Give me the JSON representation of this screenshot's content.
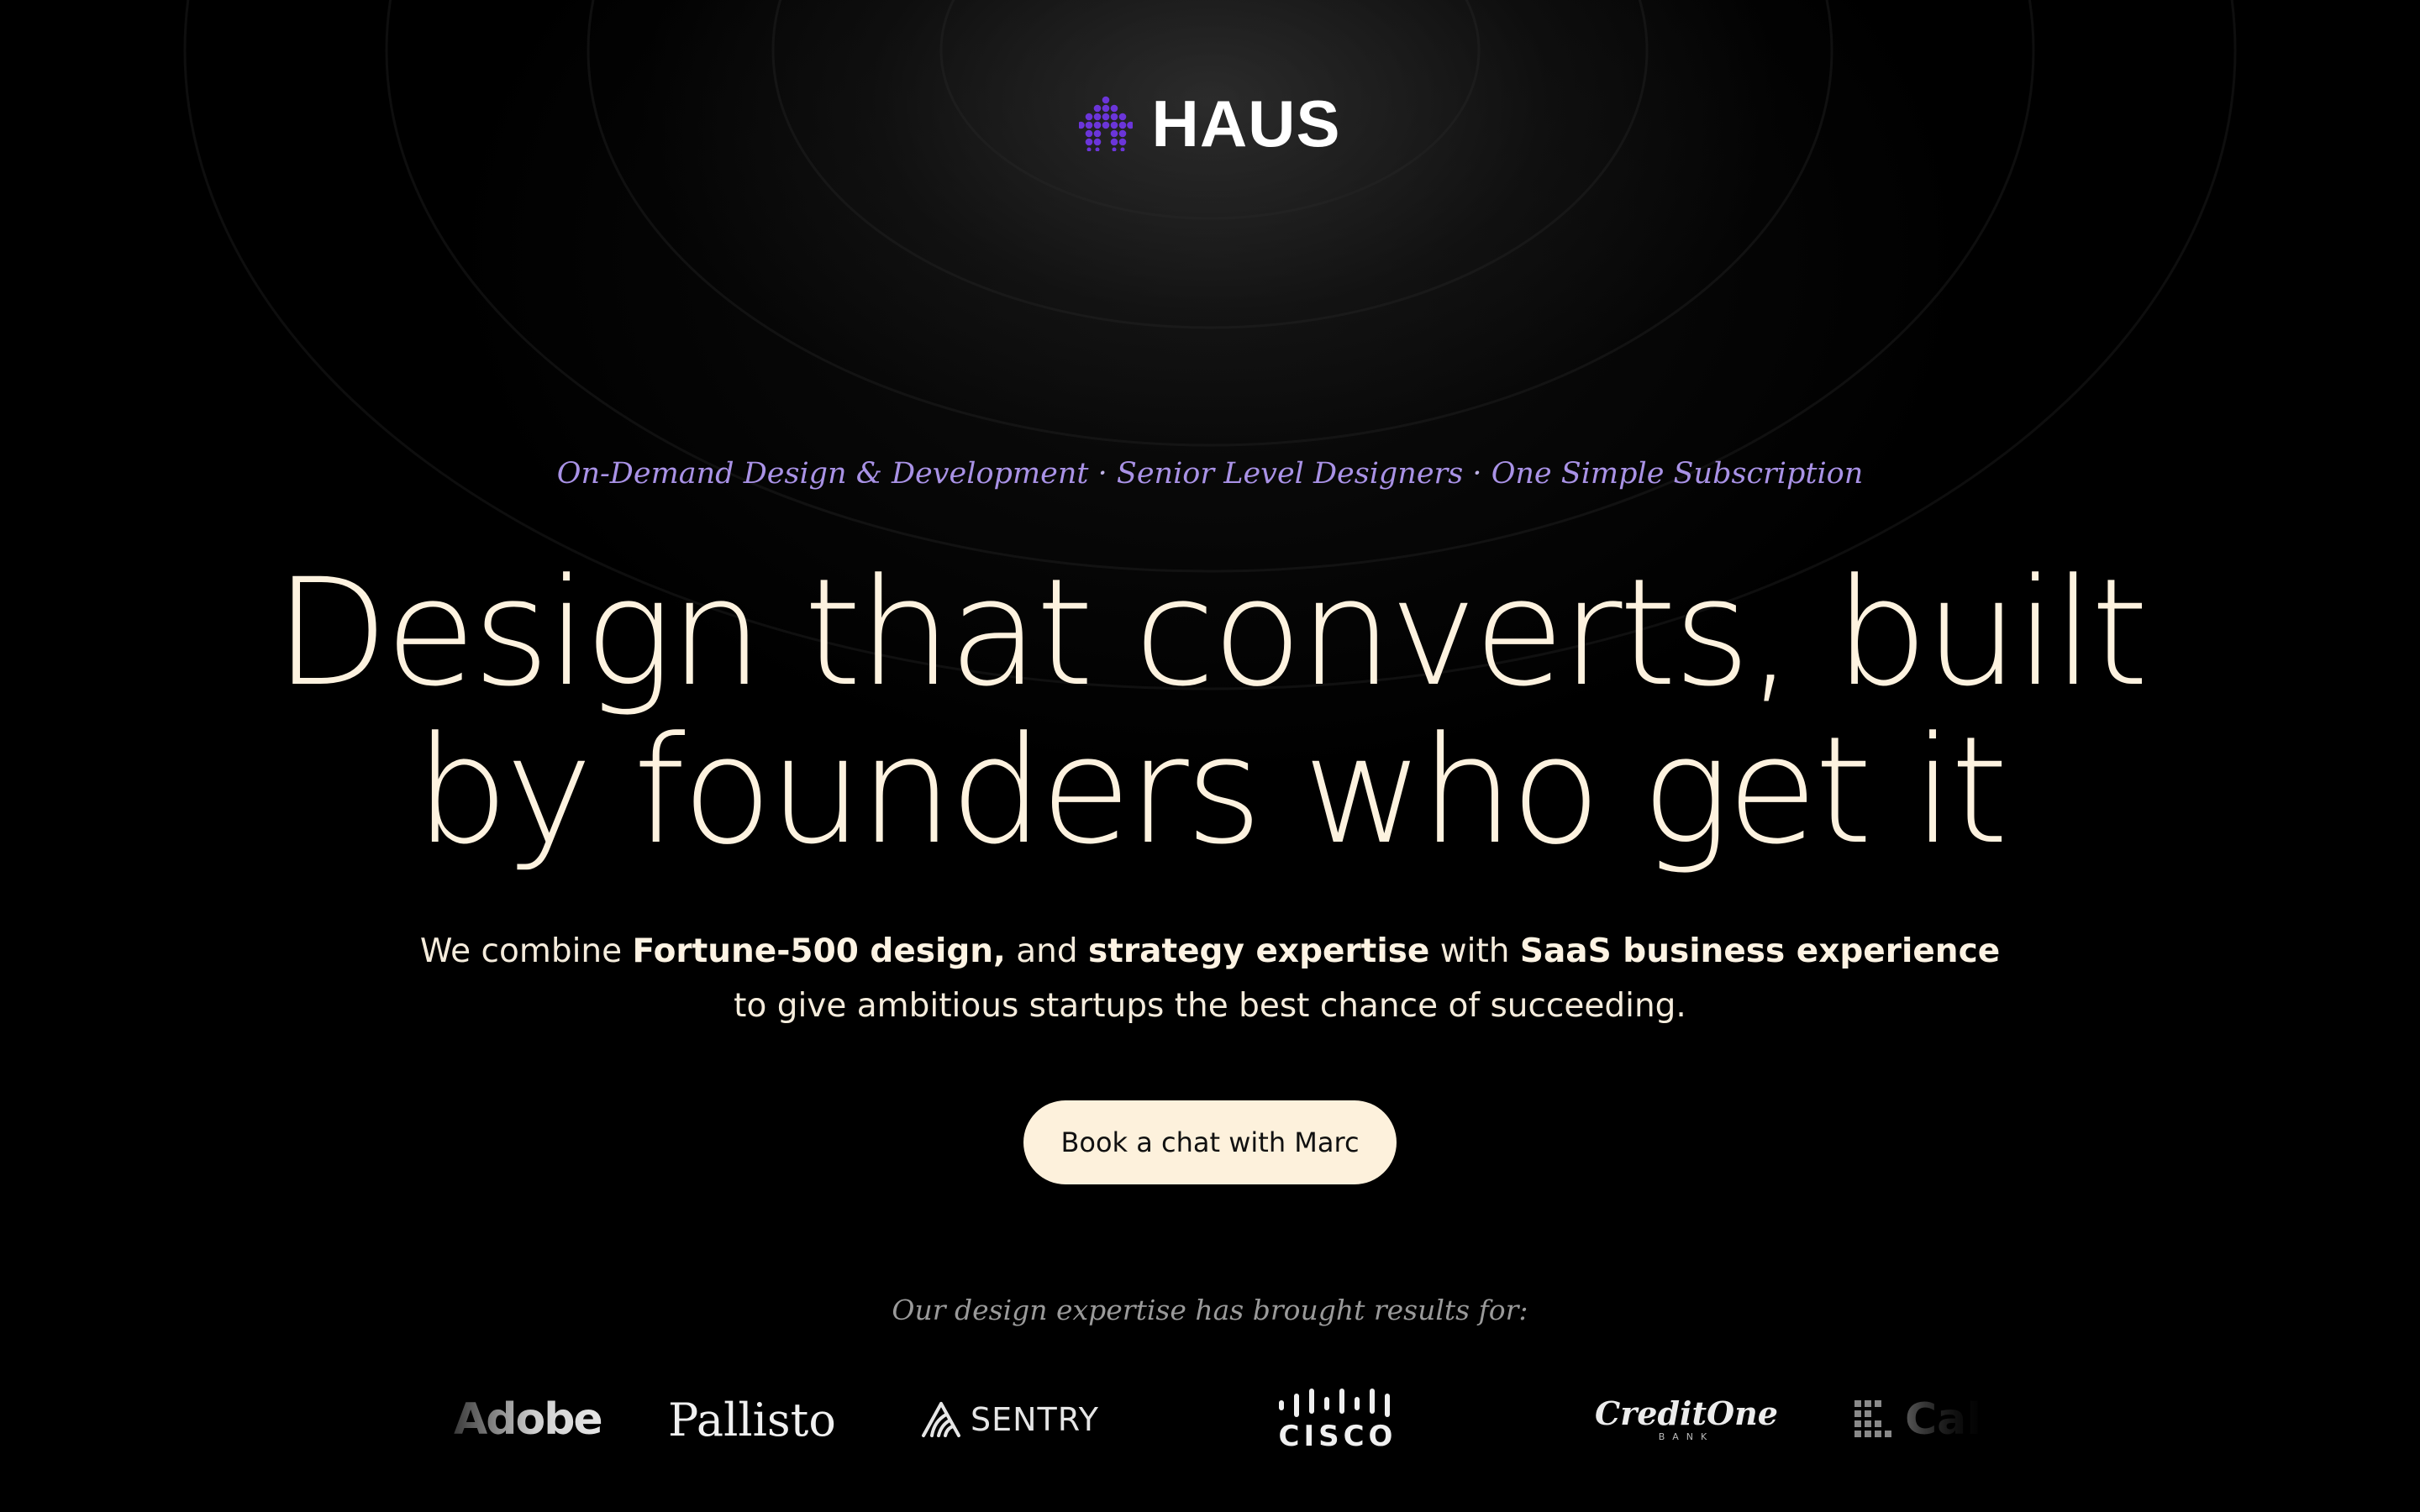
{
  "brand": {
    "name": "HAUS",
    "accent_color": "#7b3fe4"
  },
  "tagline": {
    "part1": "On-Demand Design & Development",
    "separator": "·",
    "part2": "Senior Level Designers",
    "part3": "One Simple Subscription"
  },
  "hero": {
    "headline_line1": "Design that converts, built",
    "headline_line2": "by founders who get it",
    "sub": {
      "t1": "We combine ",
      "b1": "Fortune-500 design,",
      "t2": " and ",
      "b2": "strategy expertise",
      "t3": " with ",
      "b3": "SaaS business experience",
      "line2": "to give ambitious startups the best chance of succeeding."
    },
    "cta_label": "Book a chat with Marc"
  },
  "clients": {
    "heading": "Our design expertise has brought results for:",
    "logos": [
      {
        "name": "Adobe",
        "icon": "adobe-logo"
      },
      {
        "name": "Pallisto",
        "icon": "pallisto-logo"
      },
      {
        "name": "SENTRY",
        "icon": "sentry-logo"
      },
      {
        "name": "CISCO",
        "icon": "cisco-logo"
      },
      {
        "name": "CreditOne",
        "sub": "BANK",
        "icon": "creditone-logo"
      },
      {
        "name": "Cal",
        "icon": "cal-logo"
      }
    ]
  }
}
